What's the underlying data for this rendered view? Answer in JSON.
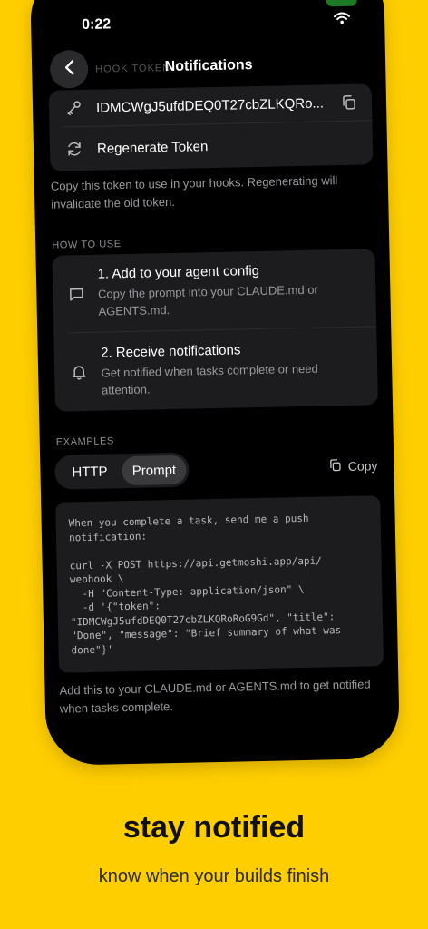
{
  "status": {
    "time": "0:22"
  },
  "nav": {
    "title": "Notifications",
    "ghost_label": "HOOK TOKEN"
  },
  "token_card": {
    "token": "IDMCWgJ5ufdDEQ0T27cbZLKQRo...",
    "regenerate_label": "Regenerate Token"
  },
  "token_caption": "Copy this token to use in your hooks. Regenerating will invalidate the old token.",
  "how_to_use": {
    "header": "HOW TO USE",
    "steps": [
      {
        "title": "1. Add to your agent config",
        "description": "Copy the prompt into your CLAUDE.md or AGENTS.md."
      },
      {
        "title": "2. Receive notifications",
        "description": "Get notified when tasks complete or need attention."
      }
    ]
  },
  "examples": {
    "header": "EXAMPLES",
    "tabs": [
      "HTTP",
      "Prompt"
    ],
    "selected_tab": "Prompt",
    "copy_label": "Copy",
    "code": "When you complete a task, send me a push\nnotification:\n\ncurl -X POST https://api.getmoshi.app/api/\nwebhook \\\n  -H \"Content-Type: application/json\" \\\n  -d '{\"token\":\n\"IDMCWgJ5ufdDEQ0T27cbZLKQRoRoG9Gd\", \"title\":\n\"Done\", \"message\": \"Brief summary of what was\ndone\"}'",
    "caption": "Add this to your CLAUDE.md or AGENTS.md to get notified when tasks complete."
  },
  "marketing": {
    "headline": "stay notified",
    "subline": "know when your builds finish"
  },
  "colors": {
    "background": "#FFCE00",
    "card": "#1c1c1e",
    "screen": "#000000"
  }
}
